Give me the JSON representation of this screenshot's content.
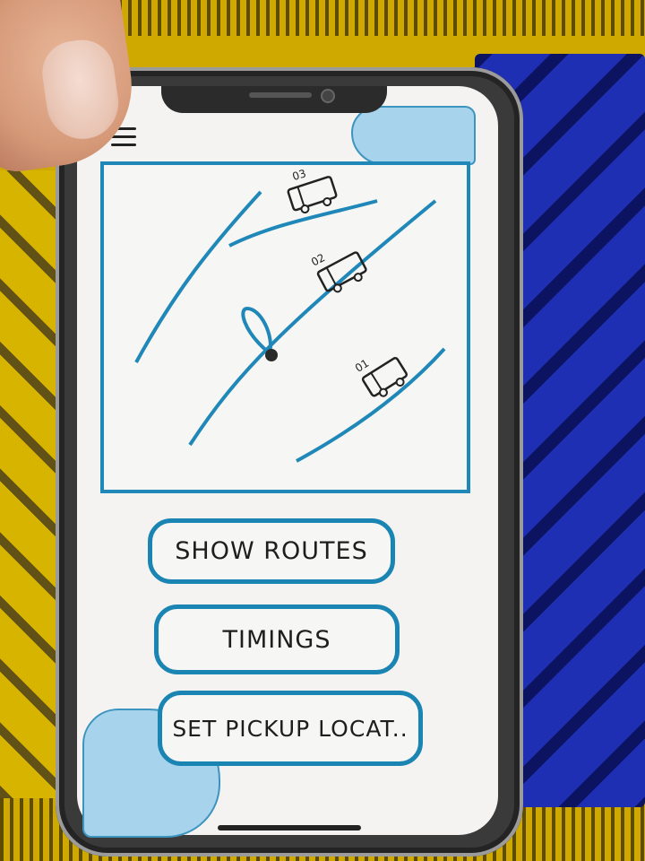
{
  "header": {
    "menu_icon": "hamburger-menu-icon"
  },
  "map": {
    "buses": [
      {
        "number": "03"
      },
      {
        "number": "02"
      },
      {
        "number": "01"
      }
    ],
    "route_color": "#1f88b8",
    "pin_icon": "location-pin-icon"
  },
  "buttons": {
    "show_routes": "SHOW ROUTES",
    "timings": "TIMINGS",
    "set_pickup": "SET PICKUP LOCAT.."
  },
  "colors": {
    "accent": "#1a84b3",
    "screen_bg": "#f4f3f1",
    "decor_blob": "#a7d3ec"
  }
}
